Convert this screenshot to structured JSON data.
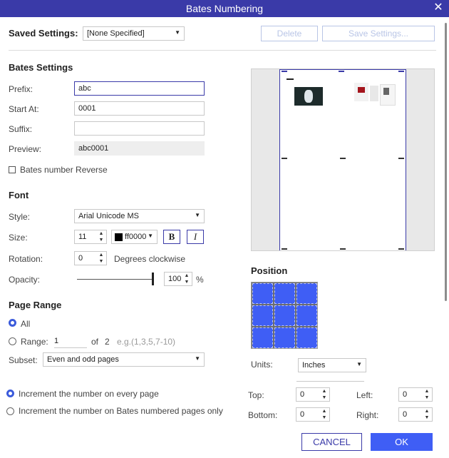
{
  "window": {
    "title": "Bates Numbering"
  },
  "saved_settings": {
    "label": "Saved Settings:",
    "value": "[None Specified]",
    "delete_label": "Delete",
    "save_label": "Save Settings..."
  },
  "bates": {
    "heading": "Bates Settings",
    "prefix_label": "Prefix:",
    "prefix_value": "abc",
    "start_label": "Start At:",
    "start_value": "0001",
    "suffix_label": "Suffix:",
    "suffix_value": "",
    "preview_label": "Preview:",
    "preview_value": "abc0001",
    "reverse_label": "Bates number Reverse"
  },
  "font": {
    "heading": "Font",
    "style_label": "Style:",
    "style_value": "Arial Unicode MS",
    "size_label": "Size:",
    "size_value": "11",
    "color_value": "ff0000",
    "bold_label": "B",
    "italic_label": "I",
    "rotation_label": "Rotation:",
    "rotation_value": "0",
    "rotation_unit": "Degrees clockwise",
    "opacity_label": "Opacity:",
    "opacity_value": "100",
    "opacity_unit": "%"
  },
  "page_range": {
    "heading": "Page Range",
    "all_label": "All",
    "range_label": "Range:",
    "range_from": "1",
    "of_label": "of",
    "total_pages": "2",
    "range_hint": "e.g.(1,3,5,7-10)",
    "subset_label": "Subset:",
    "subset_value": "Even and odd pages"
  },
  "increment": {
    "every_page": "Increment the number on every page",
    "bates_only": "Increment the number on Bates numbered pages only"
  },
  "position": {
    "heading": "Position",
    "units_label": "Units:",
    "units_value": "Inches",
    "top_label": "Top:",
    "top_value": "0",
    "left_label": "Left:",
    "left_value": "0",
    "bottom_label": "Bottom:",
    "bottom_value": "0",
    "right_label": "Right:",
    "right_value": "0"
  },
  "footer": {
    "cancel_label": "CANCEL",
    "ok_label": "OK"
  },
  "colors": {
    "accent": "#3a3aa8",
    "primary": "#3f5ef5",
    "grid_cell": "#3f5ef5"
  }
}
